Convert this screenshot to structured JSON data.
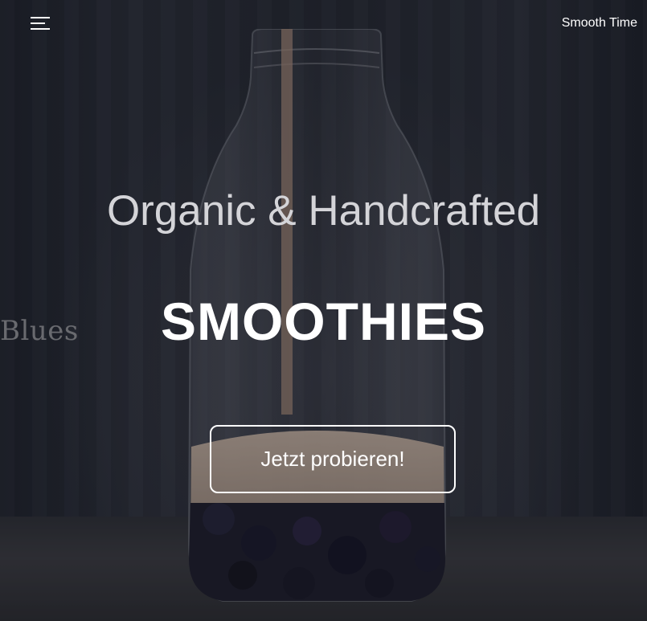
{
  "header": {
    "menu_icon": "hamburger-menu-icon",
    "brand": "Smooth Time"
  },
  "hero": {
    "subtitle": "Organic & Handcrafted",
    "title": "SMOOTHIES",
    "cta_label": "Jetzt probieren!",
    "background_text": "Blues"
  },
  "colors": {
    "text_primary": "#ffffff",
    "text_secondary": "#d4d4d8",
    "background": "#262a33"
  }
}
